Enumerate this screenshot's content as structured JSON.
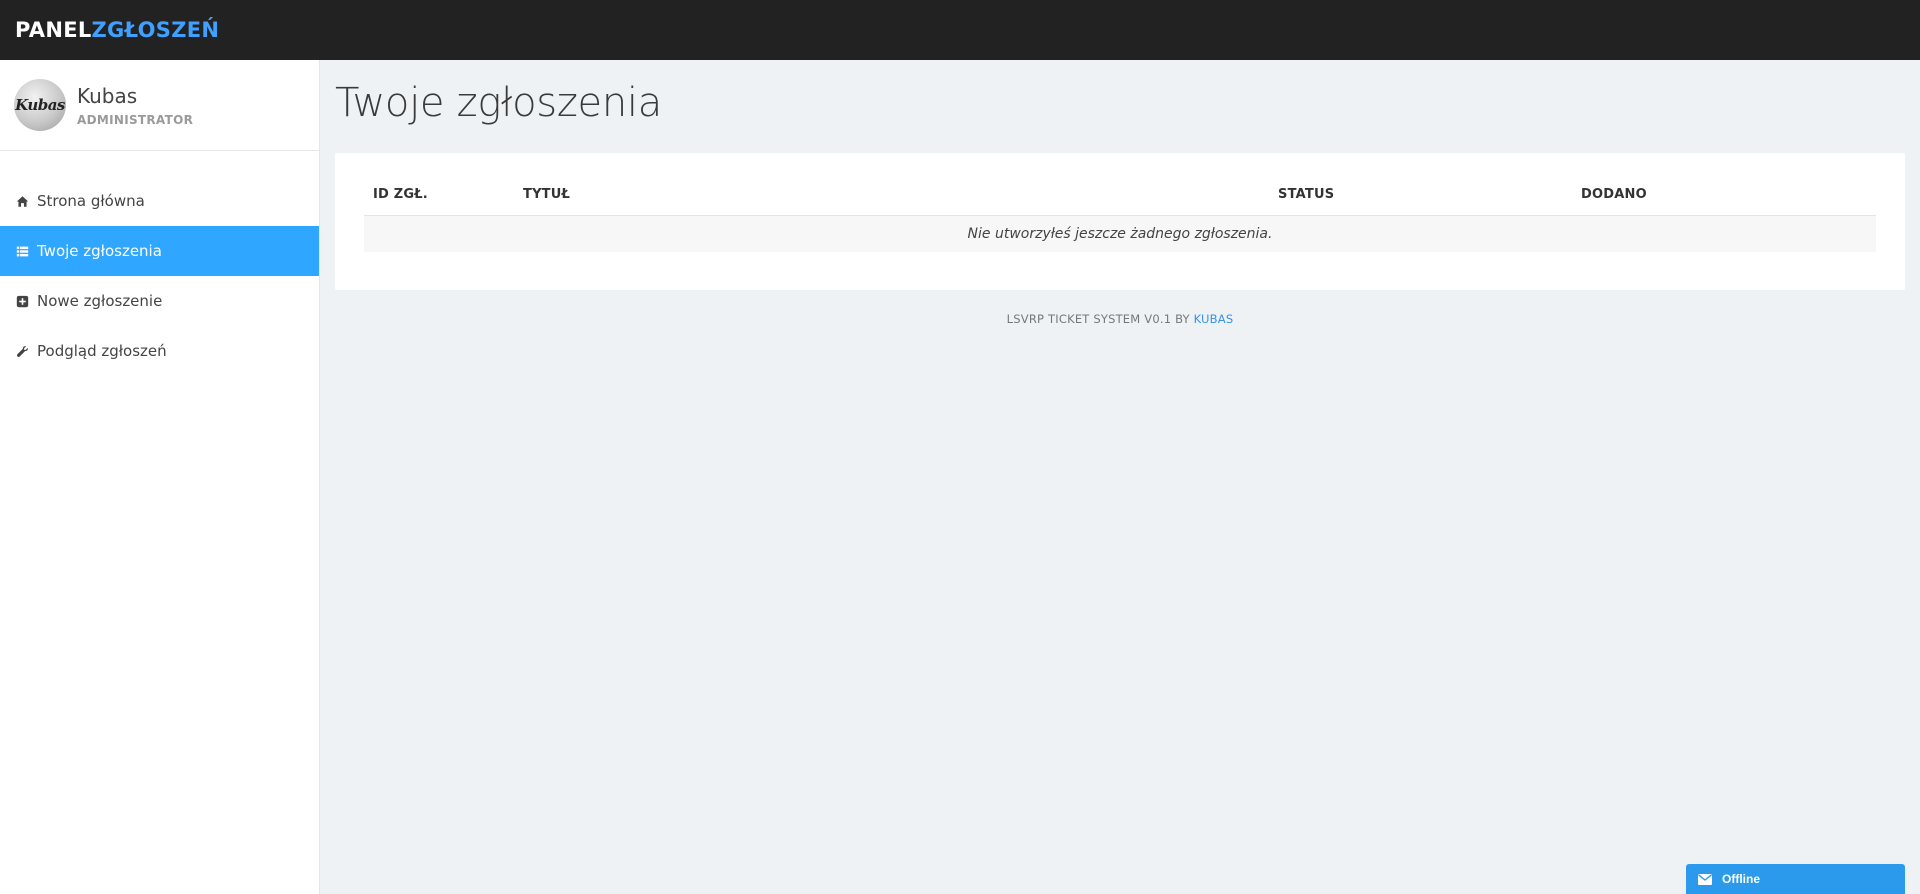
{
  "brand": {
    "part1": "PANEL",
    "part2": "ZGŁOSZEŃ"
  },
  "user": {
    "name": "Kubas",
    "role": "ADMINISTRATOR",
    "avatar_text": "Kubas"
  },
  "sidebar": {
    "items": [
      {
        "label": "Strona główna",
        "icon": "home-icon"
      },
      {
        "label": "Twoje zgłoszenia",
        "icon": "list-icon",
        "active": true
      },
      {
        "label": "Nowe zgłoszenie",
        "icon": "plus-square-icon"
      },
      {
        "label": "Podgląd zgłoszeń",
        "icon": "wrench-icon"
      }
    ]
  },
  "main": {
    "title": "Twoje zgłoszenia",
    "table": {
      "columns": [
        "ID ZGŁ.",
        "TYTUŁ",
        "STATUS",
        "DODANO"
      ],
      "empty_message": "Nie utworzyłeś jeszcze żadnego zgłoszenia."
    }
  },
  "footer": {
    "text": "LSVRP TICKET SYSTEM V0.1 BY",
    "author": "KUBAS"
  },
  "chat": {
    "status": "Offline"
  },
  "colors": {
    "accent": "#2fa6ff",
    "topbar": "#222222",
    "brand_accent": "#3fa0ff",
    "chat": "#2c9aec"
  }
}
